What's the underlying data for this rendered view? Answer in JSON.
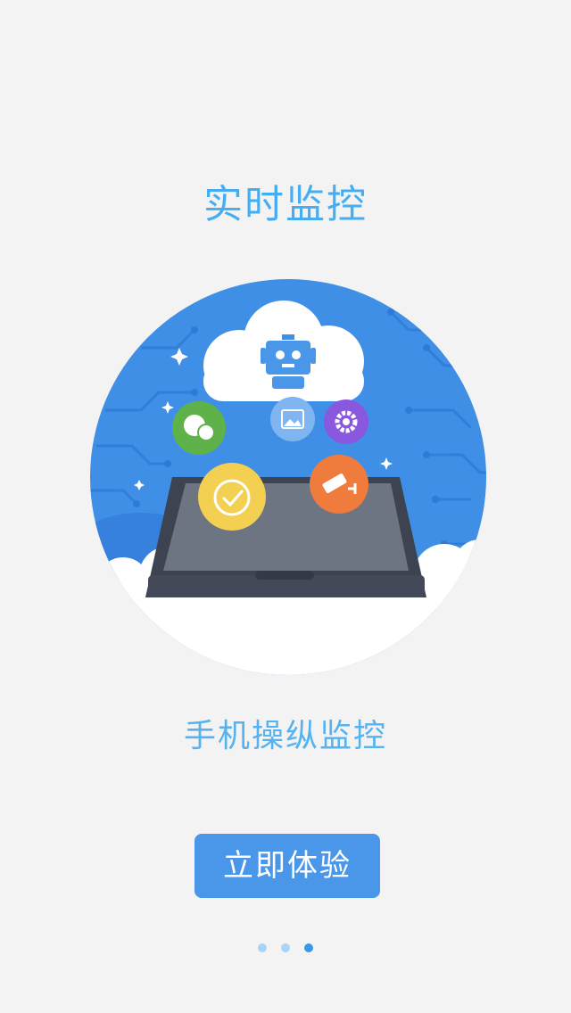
{
  "onboarding": {
    "title": "实时监控",
    "subtitle": "手机操纵监控",
    "cta_label": "立即体验",
    "page_indicator": {
      "total": 3,
      "current": 3
    }
  },
  "illustration": {
    "icons": [
      "robot-icon",
      "chat-icon",
      "image-icon",
      "settings-icon",
      "clock-icon",
      "camera-icon",
      "phone-icon",
      "cloud-icon"
    ]
  },
  "colors": {
    "accent": "#45aef2",
    "button": "#4a97ea",
    "circle_bg": "#3f8fe6",
    "chat": "#5fb24a",
    "settings": "#8a57df",
    "clock": "#f3cf52",
    "camera": "#ef7b3d",
    "image": "#7fb5f0"
  }
}
